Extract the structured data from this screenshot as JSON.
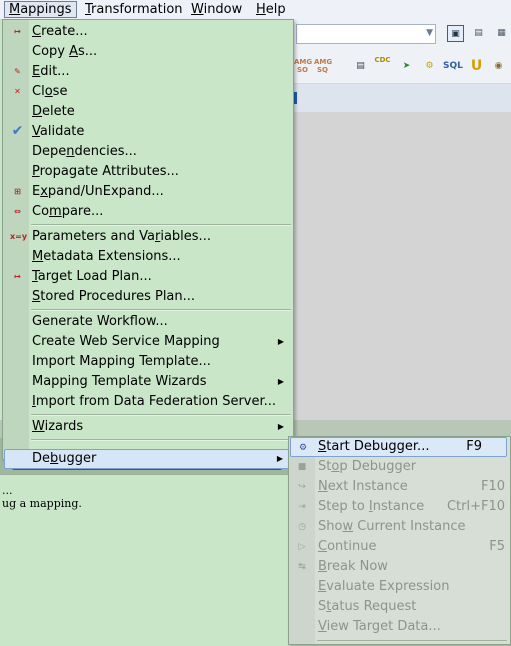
{
  "menubar": {
    "items": [
      {
        "label": "Mappings",
        "mnemonic": "M",
        "rest": "appings"
      },
      {
        "label": "Transformation",
        "mnemonic": "T",
        "rest": "ransformation"
      },
      {
        "label": "Window",
        "mnemonic": "W",
        "rest": "indow"
      },
      {
        "label": "Help",
        "mnemonic": "H",
        "rest": "elp"
      }
    ]
  },
  "toolbar": {
    "icons": [
      "workspace-icon",
      "navigator-icon",
      "output-icon",
      "refresh-icon",
      "amg-src-icon",
      "amg-tgt-icon",
      "source-qualifier-icon",
      "cdc-key-icon",
      "router-icon",
      "gear-icon",
      "sql-icon",
      "union-icon",
      "lookup-icon"
    ],
    "icon_text": {
      "amg_src": "AMG\nSO",
      "amg_tgt": "AMG\nSQ",
      "cdc": "CDC",
      "sql": "SQL",
      "union": "U"
    }
  },
  "mappings_menu": {
    "groups": [
      [
        {
          "before": "",
          "mn": "C",
          "after": "reate...",
          "icon": "create-icon"
        },
        {
          "before": "Copy ",
          "mn": "A",
          "after": "s...",
          "icon": ""
        },
        {
          "before": "",
          "mn": "E",
          "after": "dit...",
          "icon": "edit-icon"
        },
        {
          "before": "Cl",
          "mn": "o",
          "after": "se",
          "icon": "close-icon"
        },
        {
          "before": "",
          "mn": "D",
          "after": "elete",
          "icon": ""
        },
        {
          "before": "",
          "mn": "V",
          "after": "alidate",
          "icon": "validate-check-icon"
        },
        {
          "before": "Depe",
          "mn": "n",
          "after": "dencies...",
          "icon": ""
        },
        {
          "before": "",
          "mn": "P",
          "after": "ropagate Attributes...",
          "icon": ""
        },
        {
          "before": "E",
          "mn": "x",
          "after": "pand/UnExpand...",
          "icon": "expand-icon"
        },
        {
          "before": "Co",
          "mn": "m",
          "after": "pare...",
          "icon": "compare-icon"
        }
      ],
      [
        {
          "before": "Parameters and Va",
          "mn": "r",
          "after": "iables...",
          "icon": "parameters-icon"
        },
        {
          "before": "",
          "mn": "M",
          "after": "etadata Extensions...",
          "icon": ""
        },
        {
          "before": "",
          "mn": "T",
          "after": "arget Load Plan...",
          "icon": "target-load-icon"
        },
        {
          "before": "",
          "mn": "S",
          "after": "tored Procedures Plan...",
          "icon": ""
        }
      ],
      [
        {
          "before": "Generate Workflow...",
          "mn": "",
          "after": "",
          "icon": ""
        },
        {
          "before": "Create Web Service Mapping",
          "mn": "",
          "after": "",
          "icon": "",
          "submenu": true
        },
        {
          "before": "Import Mapping Template...",
          "mn": "",
          "after": "",
          "icon": ""
        },
        {
          "before": "Mapping Template Wizards",
          "mn": "",
          "after": "",
          "icon": "",
          "submenu": true
        },
        {
          "before": "",
          "mn": "I",
          "after": "mport from Data Federation Server...",
          "icon": ""
        }
      ],
      [
        {
          "before": "",
          "mn": "W",
          "after": "izards",
          "icon": "",
          "submenu": true
        }
      ],
      [
        {
          "before": "De",
          "mn": "b",
          "after": "ugger",
          "icon": "",
          "submenu": true,
          "highlight": true
        }
      ]
    ]
  },
  "debugger_menu": {
    "items": [
      {
        "before": "",
        "mn": "S",
        "after": "tart Debugger...",
        "shortcut": "F9",
        "enabled": true,
        "icon": "start-debugger-icon"
      },
      {
        "before": "St",
        "mn": "o",
        "after": "p Debugger",
        "shortcut": "",
        "enabled": false,
        "icon": "stop-debugger-icon"
      },
      {
        "before": "",
        "mn": "N",
        "after": "ext Instance",
        "shortcut": "F10",
        "enabled": false,
        "icon": "next-instance-icon"
      },
      {
        "before": "Step to ",
        "mn": "I",
        "after": "nstance",
        "shortcut": "Ctrl+F10",
        "enabled": false,
        "icon": "step-instance-icon"
      },
      {
        "before": "Sho",
        "mn": "w",
        "after": " Current Instance",
        "shortcut": "",
        "enabled": false,
        "icon": "show-instance-icon"
      },
      {
        "before": "",
        "mn": "C",
        "after": "ontinue",
        "shortcut": "F5",
        "enabled": false,
        "icon": "continue-icon"
      },
      {
        "before": "",
        "mn": "B",
        "after": "reak Now",
        "shortcut": "",
        "enabled": false,
        "icon": "break-now-icon"
      },
      {
        "before": "",
        "mn": "E",
        "after": "valuate Expression",
        "shortcut": "",
        "enabled": false,
        "icon": ""
      },
      {
        "before": "S",
        "mn": "t",
        "after": "atus Request",
        "shortcut": "",
        "enabled": false,
        "icon": ""
      },
      {
        "before": "",
        "mn": "V",
        "after": "iew Target Data...",
        "shortcut": "",
        "enabled": false,
        "icon": ""
      }
    ]
  },
  "output": {
    "lines": [
      "...",
      "ug a mapping."
    ]
  }
}
